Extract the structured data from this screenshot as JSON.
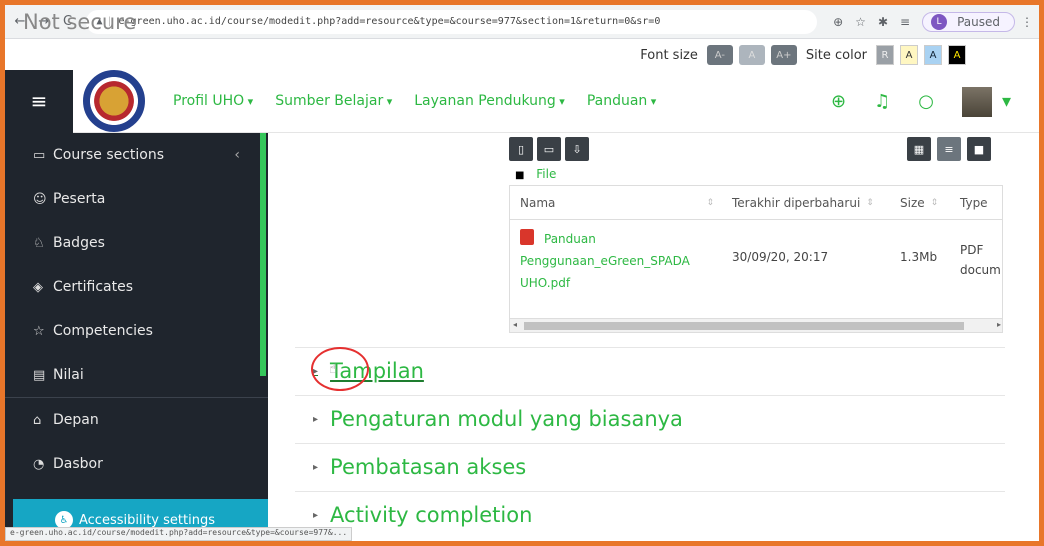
{
  "browser": {
    "back": "←",
    "forward": "→",
    "reload": "C",
    "security_label": "Not secure",
    "url": "e-green.uho.ac.id/course/modedit.php?add=resource&type=&course=977&section=1&return=0&sr=0",
    "profile_initial": "L",
    "profile_status": "Paused"
  },
  "a11y": {
    "font_size_label": "Font size",
    "font_decrease": "A-",
    "font_reset": "A",
    "font_increase": "A+",
    "site_color_label": "Site color",
    "colors": [
      "R",
      "A",
      "A",
      "A"
    ]
  },
  "navbar": {
    "menu": [
      "Profil UHO",
      "Sumber Belajar",
      "Layanan Pendukung",
      "Panduan"
    ]
  },
  "sidebar": {
    "items": [
      {
        "label": "Course sections",
        "icon": "folder-icon"
      },
      {
        "label": "Peserta",
        "icon": "users-icon"
      },
      {
        "label": "Badges",
        "icon": "badge-icon"
      },
      {
        "label": "Certificates",
        "icon": "certificate-icon"
      },
      {
        "label": "Competencies",
        "icon": "star-icon"
      },
      {
        "label": "Nilai",
        "icon": "grade-icon"
      },
      {
        "label": "Depan",
        "icon": "home-icon"
      },
      {
        "label": "Dasbor",
        "icon": "dashboard-icon"
      }
    ],
    "accessibility_button": "Accessibility settings"
  },
  "status_url": "e-green.uho.ac.id/course/modedit.php?add=resource&type=&course=977&...",
  "filepicker": {
    "path": "File",
    "columns": {
      "name": "Nama",
      "modified": "Terakhir diperbaharui",
      "size": "Size",
      "type": "Type"
    },
    "file": {
      "name_lines": [
        "Panduan",
        "Penggunaan_eGreen_SPADA",
        "UHO.pdf"
      ],
      "modified": "30/09/20, 20:17",
      "size": "1.3Mb",
      "type_lines": [
        "PDF",
        "docum"
      ]
    }
  },
  "sections": [
    "Tampilan",
    "Pengaturan modul yang biasanya",
    "Pembatasan akses",
    "Activity completion"
  ]
}
